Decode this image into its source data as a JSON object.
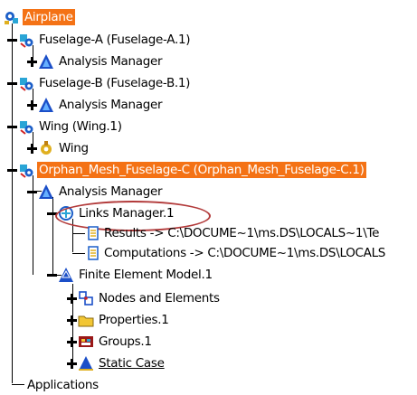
{
  "tree": {
    "root": {
      "label": "Airplane",
      "icon": "product-root-icon"
    },
    "fuselage_a": {
      "label": "Fuselage-A (Fuselage-A.1)",
      "icon": "part-gear-icon"
    },
    "fuselage_a_analysis": {
      "label": "Analysis Manager",
      "icon": "analysis-manager-icon"
    },
    "fuselage_b": {
      "label": "Fuselage-B (Fuselage-B.1)",
      "icon": "part-gear-icon"
    },
    "fuselage_b_analysis": {
      "label": "Analysis Manager",
      "icon": "analysis-manager-icon"
    },
    "wing_instance": {
      "label": "Wing (Wing.1)",
      "icon": "part-gear-icon"
    },
    "wing_part": {
      "label": "Wing",
      "icon": "part-icon"
    },
    "orphan_mesh": {
      "label": "Orphan_Mesh_Fuselage-C (Orphan_Mesh_Fuselage-C.1)",
      "icon": "part-gear-icon",
      "highlight_color": "#f47215"
    },
    "orphan_analysis": {
      "label": "Analysis Manager",
      "icon": "analysis-manager-icon"
    },
    "links_manager": {
      "label": "Links Manager.1",
      "icon": "links-manager-icon",
      "annotation_color": "#b23a3a"
    },
    "results": {
      "label": "Results -> C:\\DOCUME~1\\ms.DS\\LOCALS~1\\Te",
      "icon": "document-link-icon"
    },
    "computations": {
      "label": "Computations -> C:\\DOCUME~1\\ms.DS\\LOCALS",
      "icon": "document-link-icon"
    },
    "fem": {
      "label": "Finite Element Model.1",
      "icon": "fem-icon"
    },
    "nodes": {
      "label": "Nodes and Elements",
      "icon": "nodes-elements-icon"
    },
    "properties": {
      "label": "Properties.1",
      "icon": "folder-icon"
    },
    "groups": {
      "label": "Groups.1",
      "icon": "groups-icon"
    },
    "static_case": {
      "label": "Static Case",
      "icon": "static-case-icon"
    },
    "applications": {
      "label": "Applications"
    }
  }
}
